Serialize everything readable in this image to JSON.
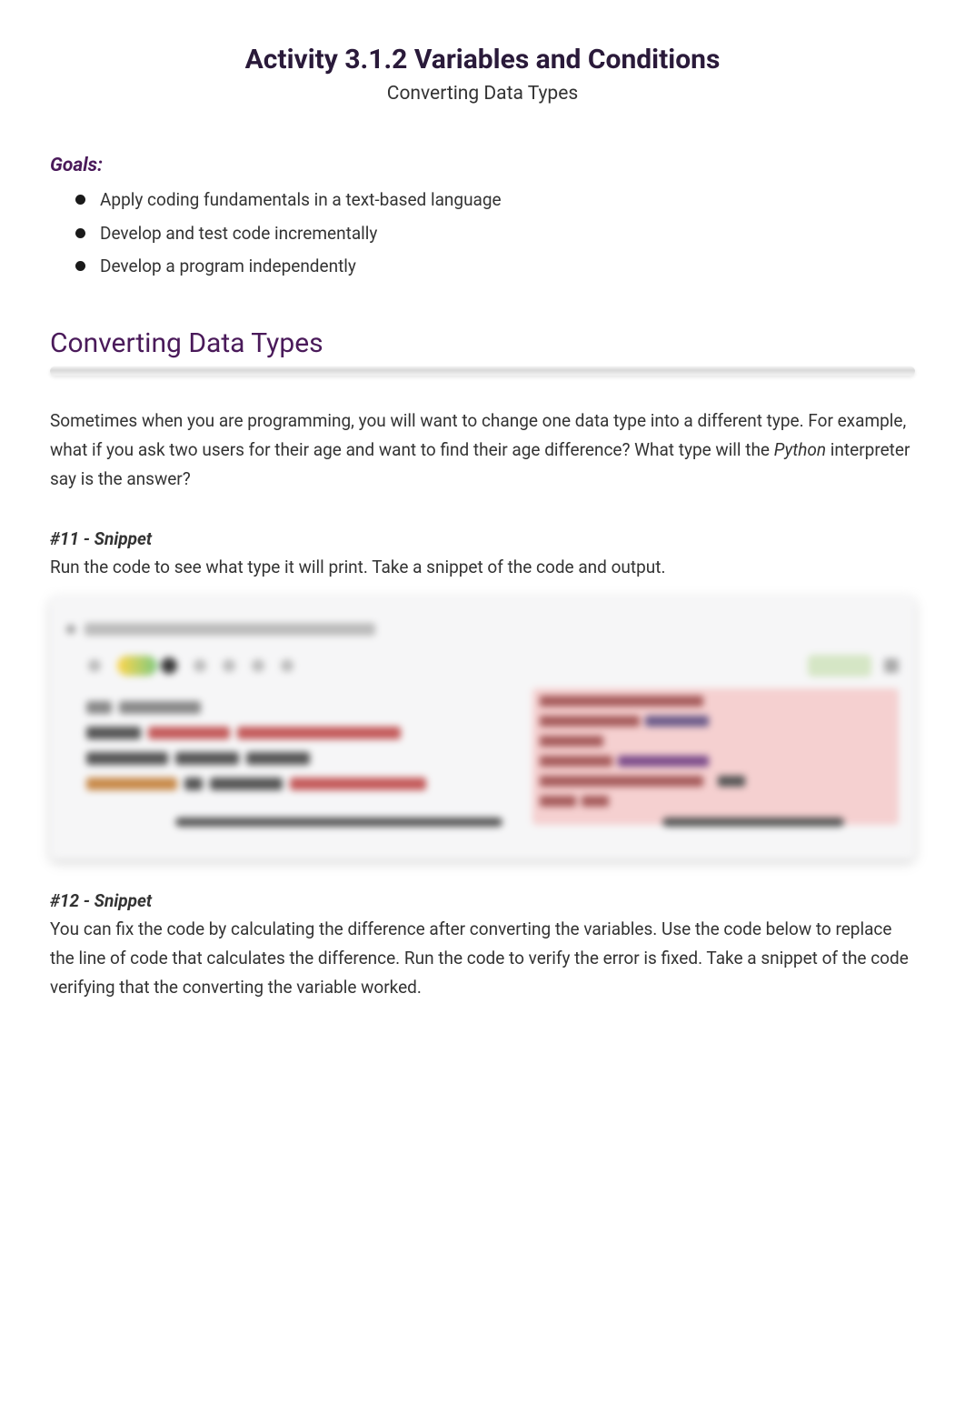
{
  "header": {
    "title": "Activity 3.1.2 Variables and Conditions",
    "subtitle": "Converting Data Types"
  },
  "goals": {
    "heading": "Goals:",
    "items": [
      "Apply coding fundamentals in a text-based language",
      "Develop and test code incrementally",
      "Develop a program independently"
    ]
  },
  "section": {
    "title": "Converting Data Types",
    "intro_part1": "Sometimes when you are programming, you will want to change one data type into a different type. For example, what if you ask two users for their age and want to find their age difference? What type will the ",
    "intro_italic": "Python",
    "intro_part2": " interpreter say is the answer?"
  },
  "snippet11": {
    "heading": "#11 - Snippet",
    "text": "Run the code to see what type it will print.  Take a snippet of the code and output."
  },
  "snippet12": {
    "heading": "#12 - Snippet",
    "text": "You can fix the code by calculating the difference after converting the variables. Use the code below to replace the line of code that calculates the difference. Run the code to verify the error is fixed.  Take a snippet of the code verifying that the converting the variable worked."
  }
}
